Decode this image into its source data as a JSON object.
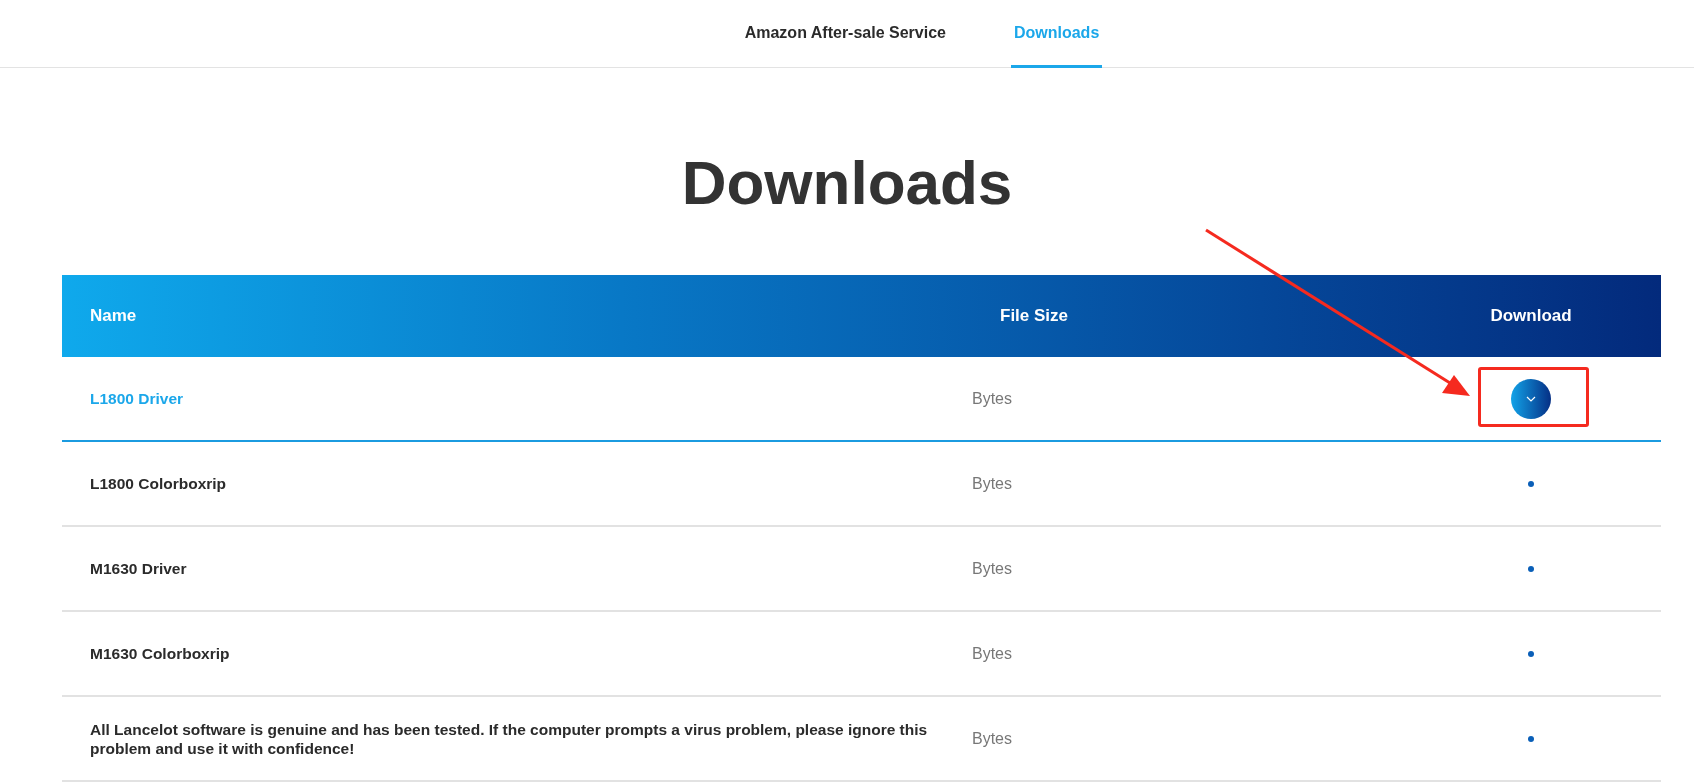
{
  "nav": {
    "tabs": [
      {
        "label": "Amazon After-sale Service",
        "selected": false
      },
      {
        "label": "Downloads",
        "selected": true
      }
    ]
  },
  "title": "Downloads",
  "table": {
    "columns": [
      "Name",
      "File Size",
      "Download"
    ],
    "rows": [
      {
        "name": "L1800 Driver",
        "size": "Bytes",
        "selected": true
      },
      {
        "name": "L1800 Colorboxrip",
        "size": "Bytes",
        "selected": false
      },
      {
        "name": "M1630 Driver",
        "size": "Bytes",
        "selected": false
      },
      {
        "name": "M1630 Colorboxrip",
        "size": "Bytes",
        "selected": false
      },
      {
        "name": "All Lancelot software is genuine and has been tested. If the computer prompts a virus problem, please ignore this problem and use it with confidence!",
        "size": "Bytes",
        "selected": false
      }
    ]
  }
}
